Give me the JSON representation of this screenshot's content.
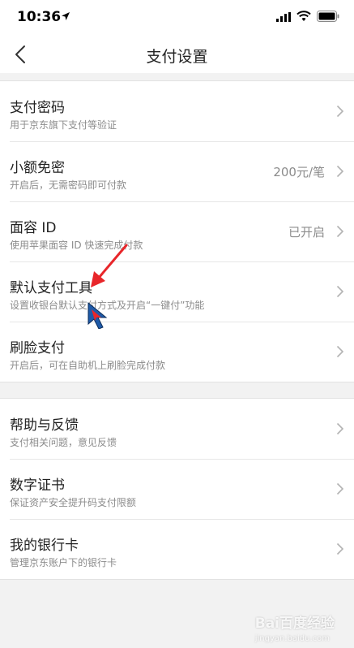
{
  "status_bar": {
    "time": "10:36"
  },
  "nav": {
    "title": "支付设置"
  },
  "groups": [
    {
      "items": [
        {
          "title": "支付密码",
          "subtitle": "用于京东旗下支付等验证",
          "value": ""
        },
        {
          "title": "小额免密",
          "subtitle": "开启后，无需密码即可付款",
          "value": "200元/笔"
        },
        {
          "title": "面容 ID",
          "subtitle": "使用苹果面容 ID 快速完成付款",
          "value": "已开启"
        },
        {
          "title": "默认支付工具",
          "subtitle": "设置收银台默认支付方式及开启“一键付”功能",
          "value": ""
        },
        {
          "title": "刷脸支付",
          "subtitle": "开启后，可在自助机上刷脸完成付款",
          "value": ""
        }
      ]
    },
    {
      "items": [
        {
          "title": "帮助与反馈",
          "subtitle": "支付相关问题，意见反馈",
          "value": ""
        },
        {
          "title": "数字证书",
          "subtitle": "保证资产安全提升码支付限额",
          "value": ""
        },
        {
          "title": "我的银行卡",
          "subtitle": "管理京东账户下的银行卡",
          "value": ""
        }
      ]
    }
  ],
  "watermark": {
    "text": "Bai百度经验",
    "sub": "jingyan.baidu.com"
  },
  "colors": {
    "annotation_arrow": "#e8262a",
    "cursor": "#1e5aa8"
  }
}
